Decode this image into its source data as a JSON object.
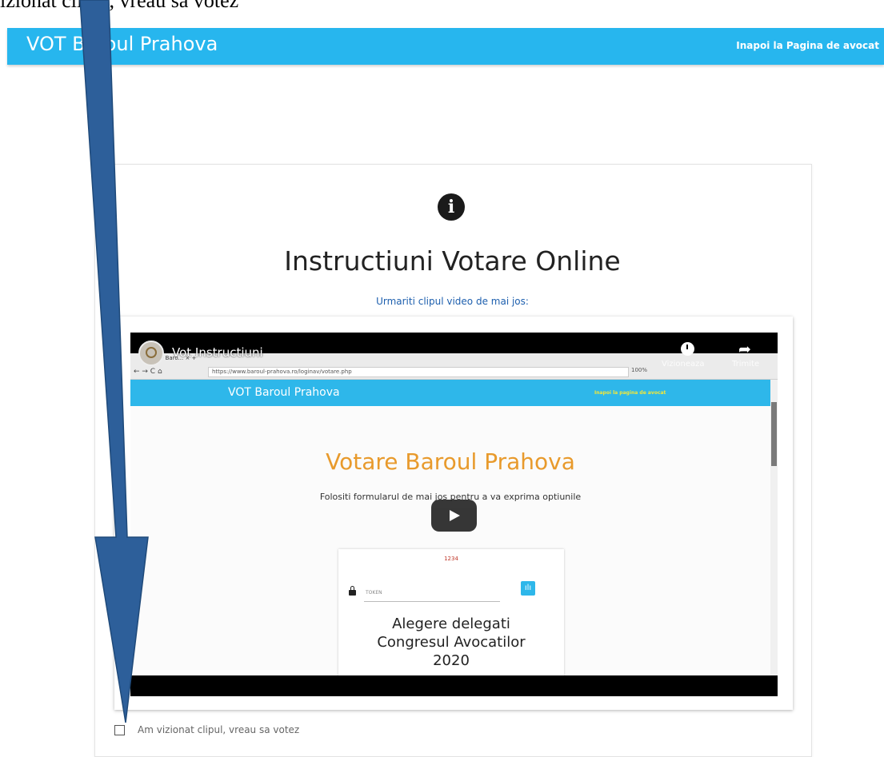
{
  "annotation": {
    "caption": "izionat clipul, vreau sa votez"
  },
  "header": {
    "brand": "VOT Baroul Prahova",
    "back_link": "Inapoi la Pagina de avocat"
  },
  "main": {
    "title": "Instructiuni Votare Online",
    "subtitle": "Urmariti clipul video de mai jos:"
  },
  "video": {
    "title": "Vot Instructiuni",
    "watch_later_label": "Vizioneaza",
    "share_label": "Trimite",
    "browser": {
      "tab": "Votare - Baro...  ×  +",
      "url": "https://www.baroul-prahova.ro/loginav/votare.php",
      "zoom": "100%"
    },
    "site": {
      "brand": "VOT Baroul Prahova",
      "back_link": "Inapoi la pagina de avocat",
      "heading": "Votare Baroul Prahova",
      "subheading": "Folositi formularul de mai jos pentru a va exprima optiunile",
      "form": {
        "code": "1234",
        "token_placeholder": "TOKEN",
        "election_title_1": "Alegere delegati",
        "election_title_2": "Congresul Avocatilor",
        "election_title_3": "2020"
      }
    }
  },
  "confirm": {
    "label": "Am vizionat clipul, vreau sa votez",
    "checked": false
  },
  "colors": {
    "header": "#27b6ee",
    "link": "#1d5fae",
    "heading_orange": "#e89a2c",
    "arrow": "#2d5f9a"
  }
}
